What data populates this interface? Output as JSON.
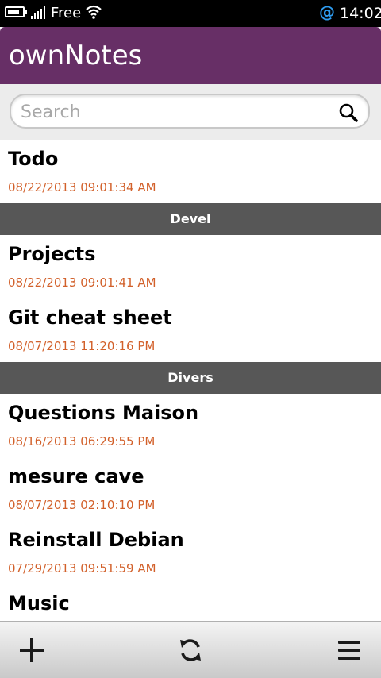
{
  "status_bar": {
    "carrier": "Free",
    "time": "14:02",
    "battery_level": 0.85,
    "icons": [
      "battery-icon",
      "signal-icon",
      "wifi-icon",
      "at-icon"
    ],
    "at_symbol": "@",
    "at_color": "#2e9cf0"
  },
  "header": {
    "title": "ownNotes",
    "color": "#672f66"
  },
  "search": {
    "placeholder": "Search",
    "value": "",
    "icon": "search-icon"
  },
  "notes": [
    {
      "title": "Todo",
      "date": "08/22/2013 09:01:34 AM"
    },
    {
      "section": "Devel"
    },
    {
      "title": "Projects",
      "date": "08/22/2013 09:01:41 AM"
    },
    {
      "title": "Git cheat sheet",
      "date": "08/07/2013 11:20:16 PM"
    },
    {
      "section": "Divers"
    },
    {
      "title": "Questions Maison",
      "date": "08/16/2013 06:29:55 PM"
    },
    {
      "title": "mesure cave",
      "date": "08/07/2013 02:10:10 PM"
    },
    {
      "title": "Reinstall Debian",
      "date": "07/29/2013 09:51:59 AM"
    },
    {
      "title": "Music",
      "date": ""
    }
  ],
  "colors": {
    "date_text": "#d2602a",
    "section_background": "#575757"
  },
  "toolbar": {
    "icons": [
      "add-icon",
      "sync-icon",
      "menu-icon"
    ]
  }
}
